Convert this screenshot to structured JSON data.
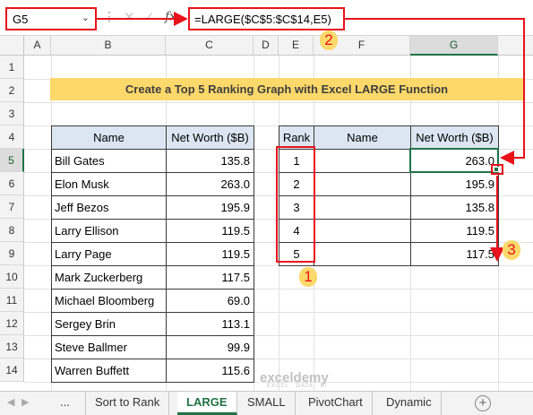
{
  "name_box": {
    "value": "G5",
    "dropdown_icon": "chevron-down-icon"
  },
  "formula_bar": {
    "separator": "⋮",
    "cancel_icon": "✕",
    "enter_icon": "✓",
    "fx_label": "fx",
    "formula": "=LARGE($C$5:$C$14,E5)"
  },
  "columns": [
    "A",
    "B",
    "C",
    "D",
    "E",
    "F",
    "G"
  ],
  "rows": [
    "1",
    "2",
    "3",
    "4",
    "5",
    "6",
    "7",
    "8",
    "9",
    "10",
    "11",
    "12",
    "13",
    "14"
  ],
  "selected": {
    "column": "G",
    "row": "5"
  },
  "title": "Create a Top 5 Ranking Graph with Excel LARGE Function",
  "source_table": {
    "headers": [
      "Name",
      "Net Worth ($B)"
    ],
    "rows": [
      [
        "Bill Gates",
        "135.8"
      ],
      [
        "Elon Musk",
        "263.0"
      ],
      [
        "Jeff Bezos",
        "195.9"
      ],
      [
        "Larry Ellison",
        "119.5"
      ],
      [
        "Larry Page",
        "119.5"
      ],
      [
        "Mark Zuckerberg",
        "117.5"
      ],
      [
        "Michael Bloomberg",
        "69.0"
      ],
      [
        "Sergey Brin",
        "113.1"
      ],
      [
        "Steve Ballmer",
        "99.9"
      ],
      [
        "Warren Buffett",
        "115.6"
      ]
    ]
  },
  "rank_table": {
    "headers": [
      "Rank",
      "Name",
      "Net Worth ($B)"
    ],
    "rows": [
      [
        "1",
        "",
        "263.0"
      ],
      [
        "2",
        "",
        "195.9"
      ],
      [
        "3",
        "",
        "135.8"
      ],
      [
        "4",
        "",
        "119.5"
      ],
      [
        "5",
        "",
        "117.5"
      ]
    ]
  },
  "annotations": {
    "step1": "1",
    "step2": "2",
    "step3": "3"
  },
  "watermark": {
    "brand": "exceldemy",
    "tagline": "EXCEL · DATA · BI"
  },
  "sheet_tabs": {
    "tabs": [
      "...",
      "Sort to Rank",
      "LARGE",
      "SMALL",
      "PivotChart",
      "Dynamic"
    ],
    "active": "LARGE",
    "add_label": "+",
    "prev_icon": "◀",
    "next_icon": "▶"
  },
  "colors": {
    "accent_red": "#e8121b",
    "excel_green": "#217346",
    "title_fill": "#fdd86a",
    "header_fill": "#dce6f2"
  }
}
